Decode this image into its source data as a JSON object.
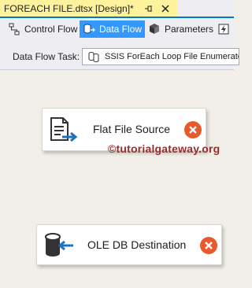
{
  "document_tab": {
    "title": "FOREACH FILE.dtsx [Design]*",
    "pin_glyph": "⊸",
    "close_glyph": "✕"
  },
  "designer_tabs": [
    {
      "label": "Control Flow",
      "icon": "control-flow-icon",
      "active": false
    },
    {
      "label": "Data Flow",
      "icon": "data-flow-icon",
      "active": true
    },
    {
      "label": "Parameters",
      "icon": "parameters-icon",
      "active": false
    },
    {
      "label": "",
      "icon": "event-handlers-icon",
      "active": false
    }
  ],
  "task_bar": {
    "label": "Data Flow Task:",
    "selected_task": "SSIS ForEach Loop File Enumerator"
  },
  "canvas": {
    "components": [
      {
        "label": "Flat File Source",
        "icon": "flat-file-source-icon",
        "status_icon": "error-icon"
      },
      {
        "label": "OLE DB Destination",
        "icon": "ole-db-destination-icon",
        "status_icon": "error-icon"
      }
    ],
    "watermark": "©tutorialgateway.org"
  },
  "colors": {
    "tab_active": "#fff29d",
    "accent": "#007acc",
    "data_flow_selected": "#3399ff",
    "error": "#e8592b",
    "watermark": "#9b2d2d"
  }
}
